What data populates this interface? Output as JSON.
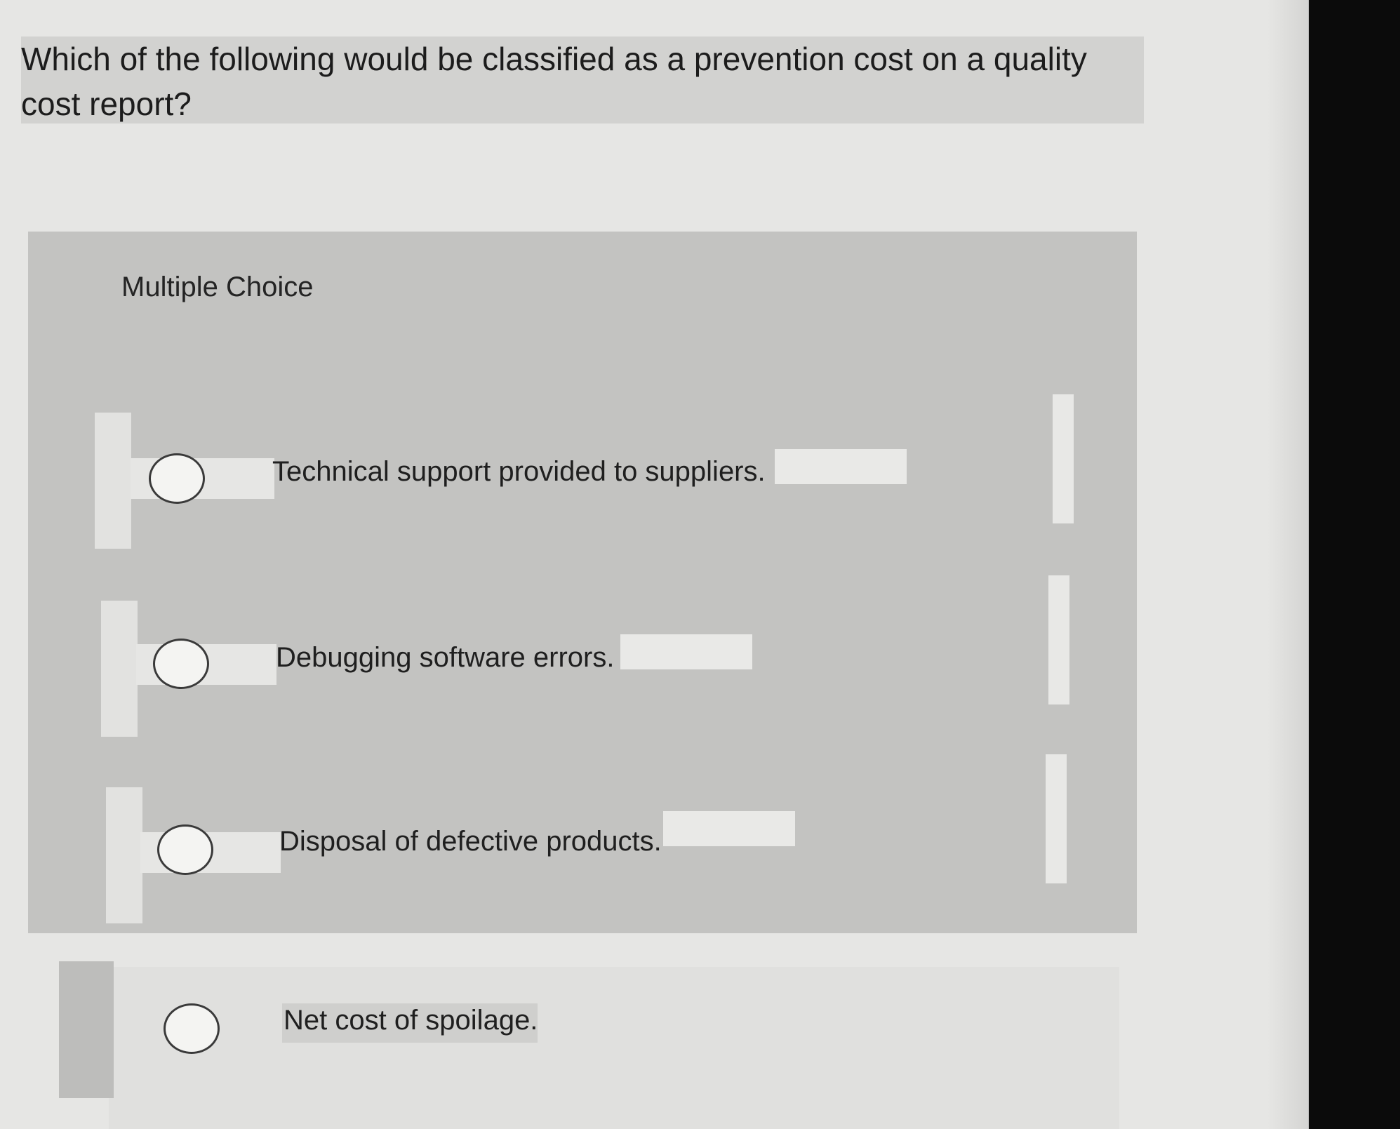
{
  "question": {
    "text": "Which of the following would be classified as a prevention cost on a quality cost report?"
  },
  "multiple_choice": {
    "heading": "Multiple Choice",
    "options": [
      {
        "label": "Technical support provided to suppliers."
      },
      {
        "label": "Debugging software errors."
      },
      {
        "label": "Disposal of defective products."
      },
      {
        "label": "Net cost of spoilage."
      }
    ]
  },
  "colors": {
    "page_background": "#e6e6e4",
    "question_background": "#d2d2d0",
    "panel_background": "#c3c3c1",
    "highlight_white": "#e8e8e6",
    "screen_edge": "#0b0b0b"
  }
}
